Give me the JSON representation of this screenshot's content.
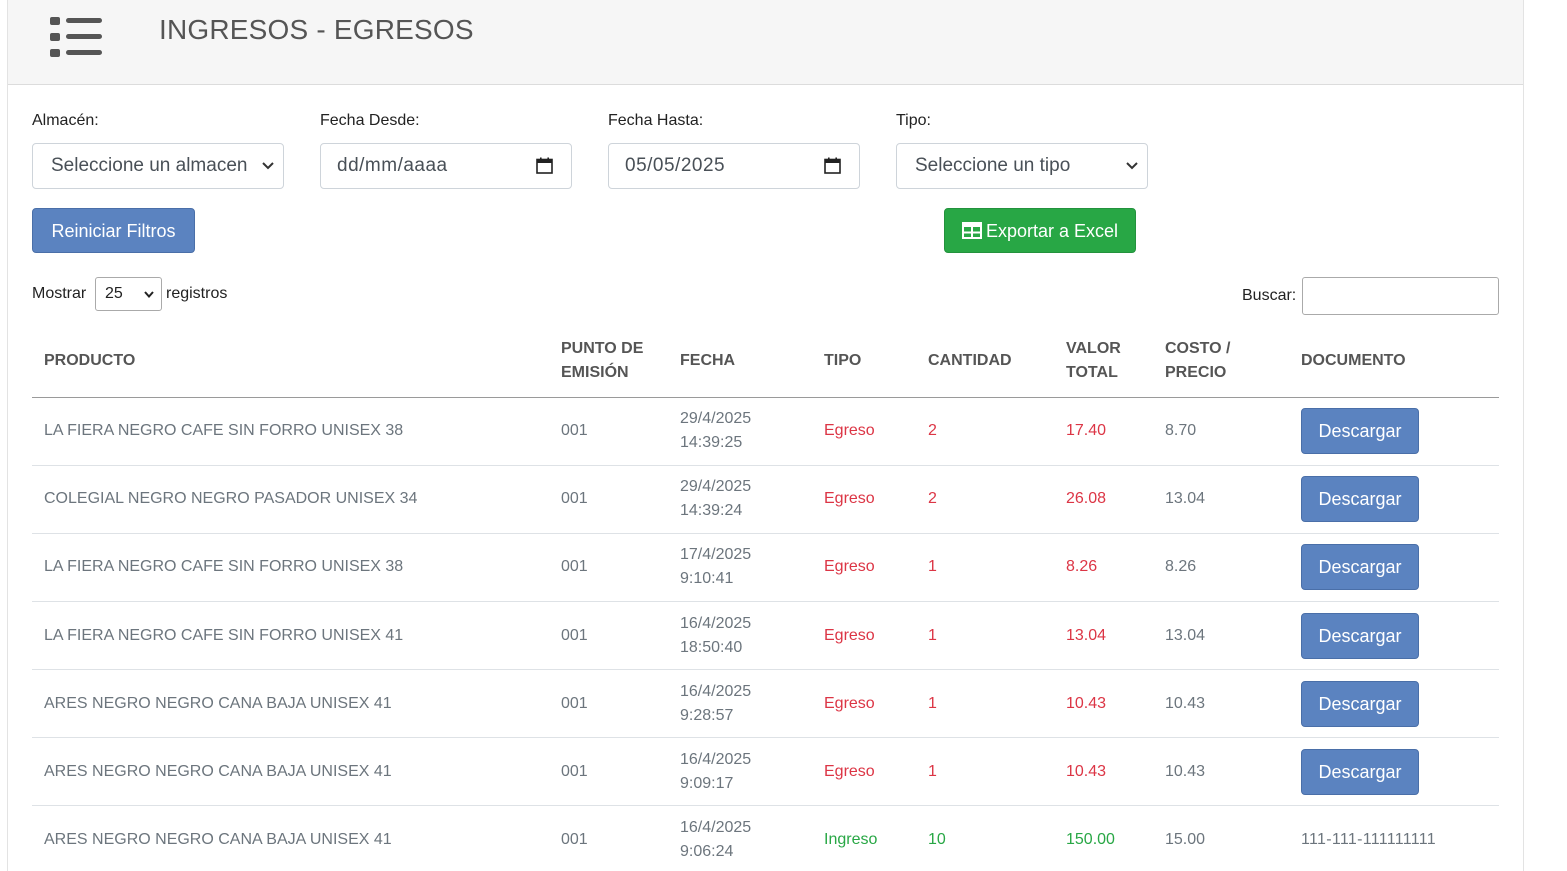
{
  "header": {
    "title": "INGRESOS - EGRESOS",
    "menu_icon": "hamburger-list-icon"
  },
  "filters": {
    "almacen_label": "Almacén:",
    "almacen_value": "Seleccione un almacen",
    "desde_label": "Fecha Desde:",
    "desde_value": "dd/mm/aaaa",
    "hasta_label": "Fecha Hasta:",
    "hasta_value": "05/05/2025",
    "tipo_label": "Tipo:",
    "tipo_value": "Seleccione un tipo"
  },
  "actions": {
    "reset_label": "Reiniciar Filtros",
    "export_label": "Exportar a Excel"
  },
  "table_controls": {
    "show_label": "Mostrar",
    "length_value": "25",
    "records_label": "registros",
    "search_label": "Buscar:",
    "search_value": ""
  },
  "table": {
    "columns": {
      "producto": "PRODUCTO",
      "punto_1": "PUNTO DE",
      "punto_2": "EMISIÓN",
      "fecha": "FECHA",
      "tipo": "TIPO",
      "cantidad": "CANTIDAD",
      "valor_1": "VALOR",
      "valor_2": "TOTAL",
      "costo_1": "COSTO /",
      "costo_2": "PRECIO",
      "documento": "DOCUMENTO"
    },
    "rows": [
      {
        "producto": "LA FIERA NEGRO CAFE SIN FORRO UNISEX 38",
        "punto": "001",
        "fecha": "29/4/2025",
        "hora": "14:39:25",
        "tipo": "Egreso",
        "cantidad": "2",
        "valor": "17.40",
        "costo": "8.70",
        "documento": "Descargar"
      },
      {
        "producto": "COLEGIAL NEGRO NEGRO PASADOR UNISEX 34",
        "punto": "001",
        "fecha": "29/4/2025",
        "hora": "14:39:24",
        "tipo": "Egreso",
        "cantidad": "2",
        "valor": "26.08",
        "costo": "13.04",
        "documento": "Descargar"
      },
      {
        "producto": "LA FIERA NEGRO CAFE SIN FORRO UNISEX 38",
        "punto": "001",
        "fecha": "17/4/2025",
        "hora": "9:10:41",
        "tipo": "Egreso",
        "cantidad": "1",
        "valor": "8.26",
        "costo": "8.26",
        "documento": "Descargar"
      },
      {
        "producto": "LA FIERA NEGRO CAFE SIN FORRO UNISEX 41",
        "punto": "001",
        "fecha": "16/4/2025",
        "hora": "18:50:40",
        "tipo": "Egreso",
        "cantidad": "1",
        "valor": "13.04",
        "costo": "13.04",
        "documento": "Descargar"
      },
      {
        "producto": "ARES NEGRO NEGRO CANA BAJA UNISEX 41",
        "punto": "001",
        "fecha": "16/4/2025",
        "hora": "9:28:57",
        "tipo": "Egreso",
        "cantidad": "1",
        "valor": "10.43",
        "costo": "10.43",
        "documento": "Descargar"
      },
      {
        "producto": "ARES NEGRO NEGRO CANA BAJA UNISEX 41",
        "punto": "001",
        "fecha": "16/4/2025",
        "hora": "9:09:17",
        "tipo": "Egreso",
        "cantidad": "1",
        "valor": "10.43",
        "costo": "10.43",
        "documento": "Descargar"
      },
      {
        "producto": "ARES NEGRO NEGRO CANA BAJA UNISEX 41",
        "punto": "001",
        "fecha": "16/4/2025",
        "hora": "9:06:24",
        "tipo": "Ingreso",
        "cantidad": "10",
        "valor": "150.00",
        "costo": "15.00",
        "documento": "111-111-111111111"
      }
    ]
  },
  "colors": {
    "primary_button": "#5b83c0",
    "excel_button": "#28a745",
    "egreso": "#dc3545",
    "ingreso": "#28a745",
    "header_bg": "#f6f6f6"
  }
}
